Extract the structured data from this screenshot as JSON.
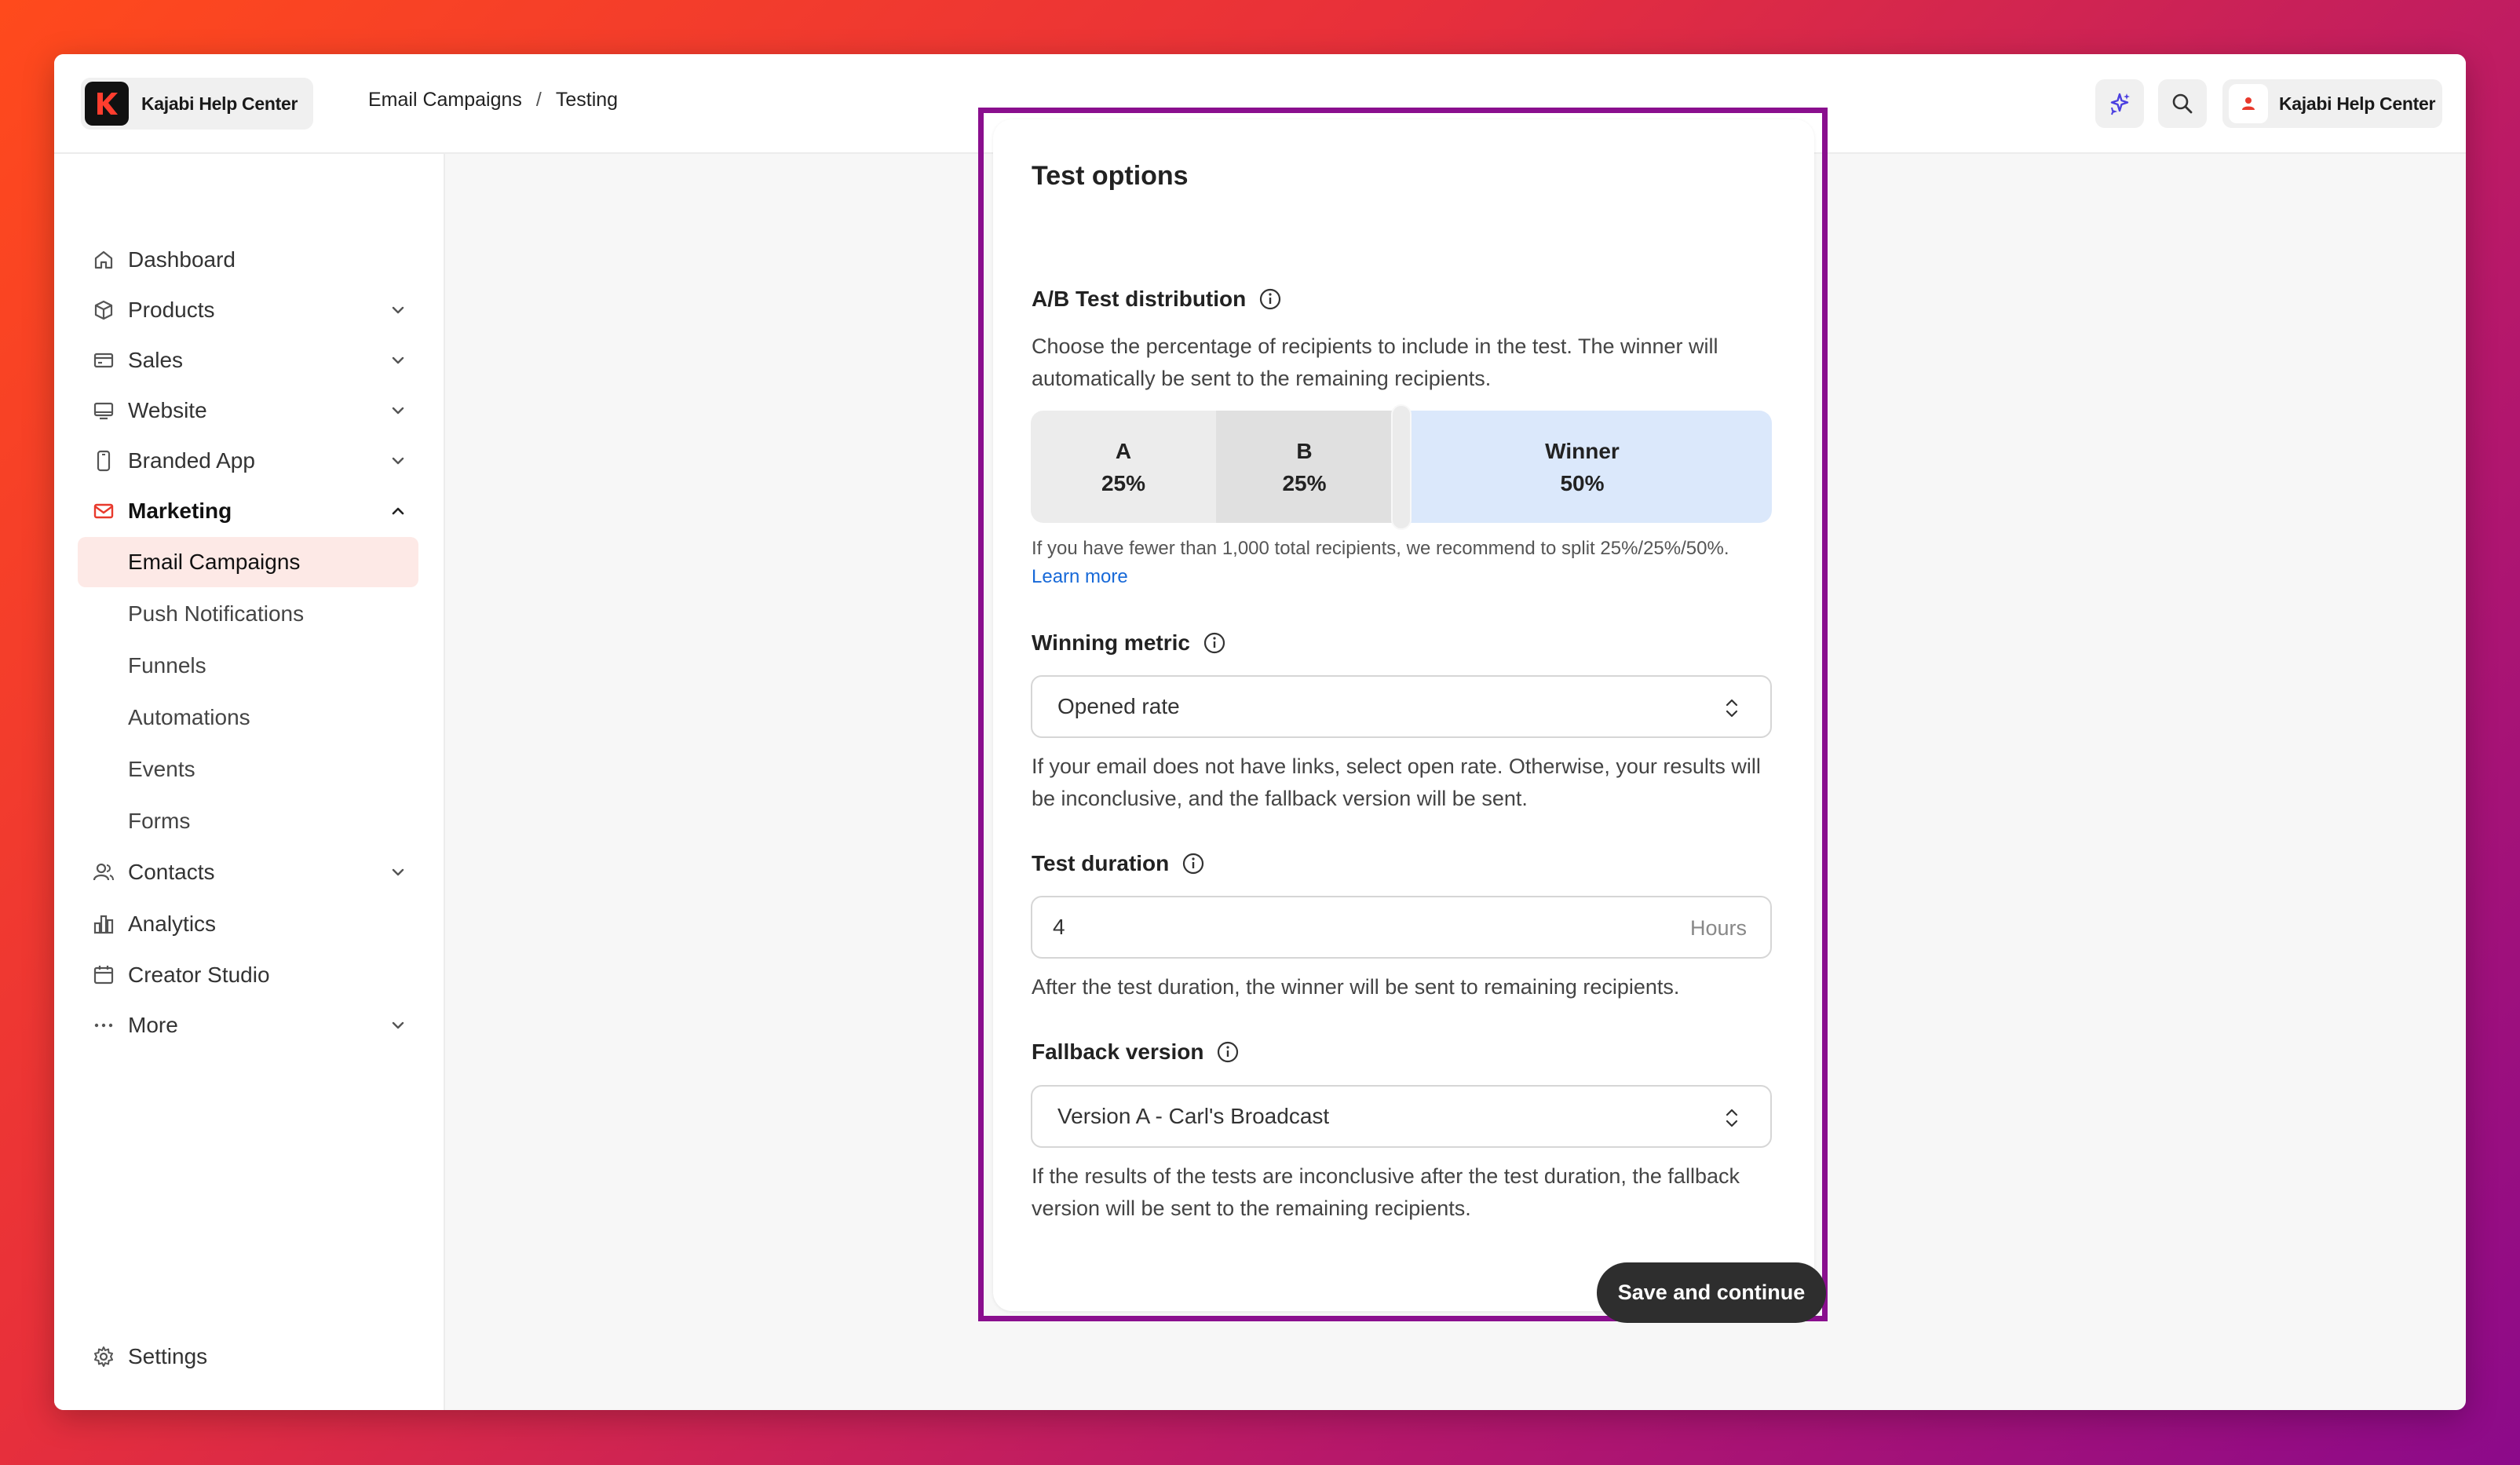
{
  "header": {
    "brand_name": "Kajabi Help Center",
    "breadcrumb": [
      "Email Campaigns",
      "Testing"
    ],
    "user_name": "Kajabi Help Center"
  },
  "sidebar": {
    "items": [
      {
        "label": "Dashboard",
        "icon": "home-icon"
      },
      {
        "label": "Products",
        "icon": "box-icon",
        "expandable": true
      },
      {
        "label": "Sales",
        "icon": "credit-card-icon",
        "expandable": true
      },
      {
        "label": "Website",
        "icon": "monitor-icon",
        "expandable": true
      },
      {
        "label": "Branded App",
        "icon": "phone-icon",
        "expandable": true
      },
      {
        "label": "Marketing",
        "icon": "mail-icon",
        "expandable": true,
        "expanded": true
      },
      {
        "label": "Contacts",
        "icon": "users-icon",
        "expandable": true
      },
      {
        "label": "Analytics",
        "icon": "bar-chart-icon"
      },
      {
        "label": "Creator Studio",
        "icon": "calendar-icon"
      },
      {
        "label": "More",
        "icon": "more-dots-icon",
        "expandable": true
      }
    ],
    "marketing_children": [
      "Email Campaigns",
      "Push Notifications",
      "Funnels",
      "Automations",
      "Events",
      "Forms"
    ],
    "selected_child": "Email Campaigns",
    "settings_label": "Settings"
  },
  "card": {
    "title": "Test options",
    "distribution": {
      "label": "A/B Test distribution",
      "description": "Choose the percentage of recipients to include in the test. The winner will automatically be sent to the remaining recipients.",
      "segments": [
        {
          "name": "A",
          "percent": "25%"
        },
        {
          "name": "B",
          "percent": "25%"
        },
        {
          "name": "Winner",
          "percent": "50%"
        }
      ],
      "note": "If you have fewer than 1,000 total recipients, we recommend to split 25%/25%/50%.",
      "learn_more": "Learn more"
    },
    "winning_metric": {
      "label": "Winning metric",
      "value": "Opened rate",
      "help": "If your email does not have links, select open rate. Otherwise, your results will be inconclusive, and the fallback version will be sent."
    },
    "test_duration": {
      "label": "Test duration",
      "value": "4",
      "unit": "Hours",
      "help": "After the test duration, the winner will be sent to remaining recipients."
    },
    "fallback": {
      "label": "Fallback version",
      "value": "Version A - Carl's Broadcast",
      "help": "If the results of the tests are inconclusive after the test duration, the fallback version will be sent to the remaining recipients."
    },
    "save_label": "Save and continue"
  },
  "colors": {
    "accent": "#e8392c",
    "highlight_frame": "#8a0f8e",
    "winner_segment": "#dbe8fb",
    "primary_button": "#2e2e2e",
    "link": "#1769d8"
  }
}
